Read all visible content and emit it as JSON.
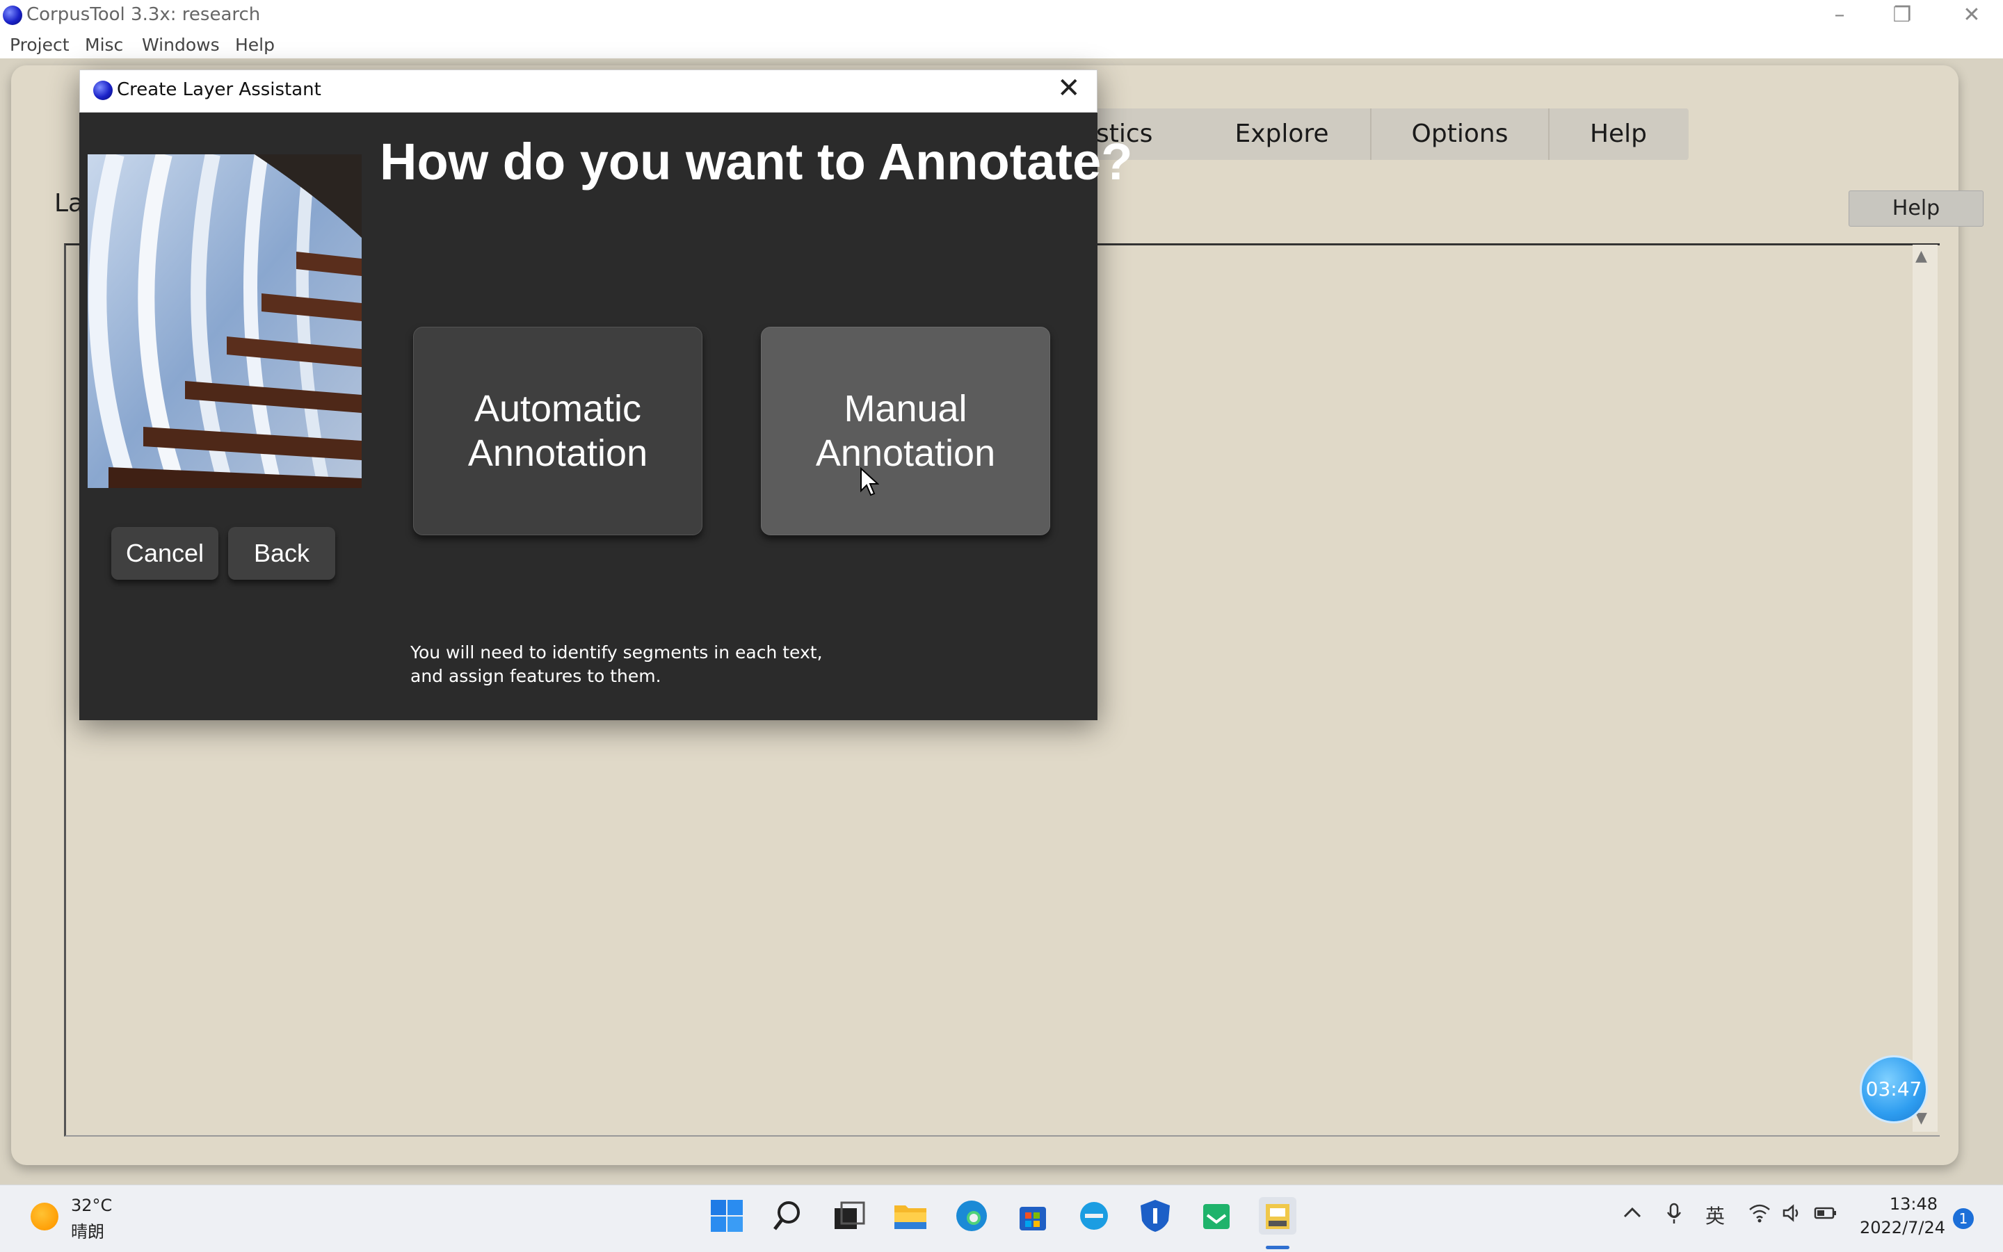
{
  "window": {
    "title": "CorpusTool 3.3x: research",
    "controls": {
      "minimize": "–",
      "maximize": "❐",
      "close": "✕"
    }
  },
  "menubar": {
    "items": [
      "Project",
      "Misc",
      "Windows",
      "Help"
    ]
  },
  "main": {
    "tabs": [
      "stics",
      "Explore",
      "Options",
      "Help"
    ],
    "layers_label": "La",
    "help_button": "Help",
    "timer": "03:47"
  },
  "dialog": {
    "title": "Create Layer Assistant",
    "close": "✕",
    "heading": "How do you want to Annotate?",
    "automatic": {
      "line1": "Automatic",
      "line2": "Annotation"
    },
    "manual": {
      "line1": "Manual",
      "line2": "Annotation"
    },
    "cancel": "Cancel",
    "back": "Back",
    "hint_line1": "You will need to identify segments in each text,",
    "hint_line2": "and assign features to them."
  },
  "taskbar": {
    "weather_temp": "32°C",
    "weather_desc": "晴朗",
    "ime": "英",
    "time": "13:48",
    "date": "2022/7/24",
    "notifications": "1",
    "icons": [
      "windows-start-icon",
      "search-icon",
      "task-view-icon",
      "file-explorer-icon",
      "edge-icon",
      "store-icon",
      "ie-icon",
      "shield-app-icon",
      "mail-icon",
      "corpustool-icon"
    ]
  },
  "colors": {
    "dialog_bg": "#2b2b2b",
    "app_bg": "#e0d9c8",
    "accent": "#2f6fd0"
  }
}
